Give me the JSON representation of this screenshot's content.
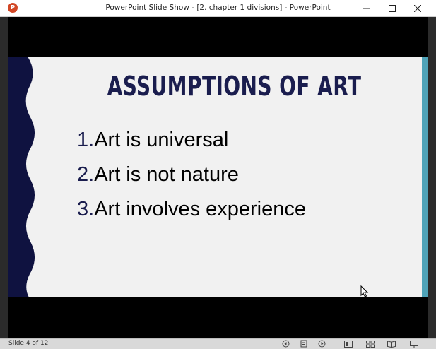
{
  "window": {
    "title": "PowerPoint Slide Show - [2. chapter 1 divisions] - PowerPoint",
    "app_icon_letter": "P",
    "controls": {
      "minimize": "—",
      "maximize": "☐",
      "close": "✕"
    }
  },
  "slide": {
    "title": "ASSUMPTIONS OF ART",
    "items": [
      {
        "number": "1.",
        "text": "Art is universal"
      },
      {
        "number": "2.",
        "text": "Art is not nature"
      },
      {
        "number": "3.",
        "text": "Art involves experience"
      }
    ],
    "colors": {
      "band": "#0f1240",
      "title": "#1a1d4e",
      "accent": "#4fa3b8",
      "background": "#f1f1f1"
    }
  },
  "statusbar": {
    "slide_counter": "Slide 4 of 12",
    "icons": [
      "previous-icon",
      "menu-icon",
      "next-icon",
      "normal-view-icon",
      "slide-sorter-icon",
      "reading-view-icon",
      "slide-show-icon"
    ]
  }
}
